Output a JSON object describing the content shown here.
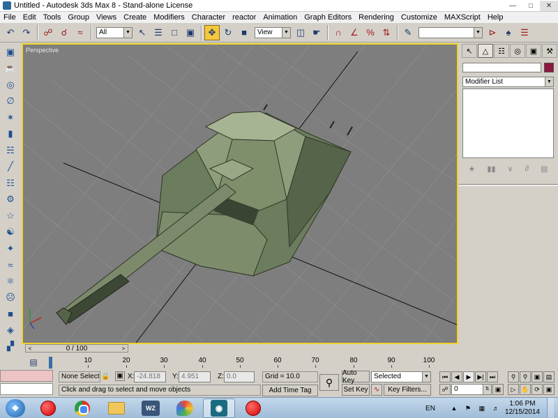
{
  "window": {
    "title": "Untitled - Autodesk 3ds Max 8 - Stand-alone License",
    "minimize_icon": "minimize-icon",
    "maximize_icon": "maximize-icon",
    "close_icon": "close-icon"
  },
  "menu": [
    "File",
    "Edit",
    "Tools",
    "Group",
    "Views",
    "Create",
    "Modifiers",
    "Character",
    "reactor",
    "Animation",
    "Graph Editors",
    "Rendering",
    "Customize",
    "MAXScript",
    "Help"
  ],
  "toolbar": {
    "selection_filter": "All",
    "reference_coord": "View"
  },
  "viewport": {
    "label": "Perspective"
  },
  "command_panel": {
    "modifier_list": "Modifier List",
    "object_color": "#8d1740"
  },
  "time_slider": {
    "frame": "0 / 100",
    "left_arrow": "<",
    "right_arrow": ">"
  },
  "track_bar": {
    "ticks": [
      10,
      20,
      30,
      40,
      50,
      60,
      70,
      80,
      90,
      100
    ]
  },
  "status": {
    "selection": "None Selecte",
    "prompt": "Click and drag to select and move objects",
    "x_label": "X:",
    "x_value": "-24.818",
    "y_label": "Y:",
    "y_value": "4.951",
    "z_label": "Z:",
    "z_value": "0.0",
    "grid": "Grid = 10.0",
    "add_time_tag": "Add Time Tag",
    "auto_key": "Auto Key",
    "set_key": "Set Key",
    "key_mode": "Selected",
    "key_filters": "Key Filters...",
    "current_frame": "0"
  },
  "taskbar": {
    "start": "Start",
    "language": "EN",
    "time": "1:06 PM",
    "date": "12/15/2014",
    "wz_label": "WZ"
  }
}
